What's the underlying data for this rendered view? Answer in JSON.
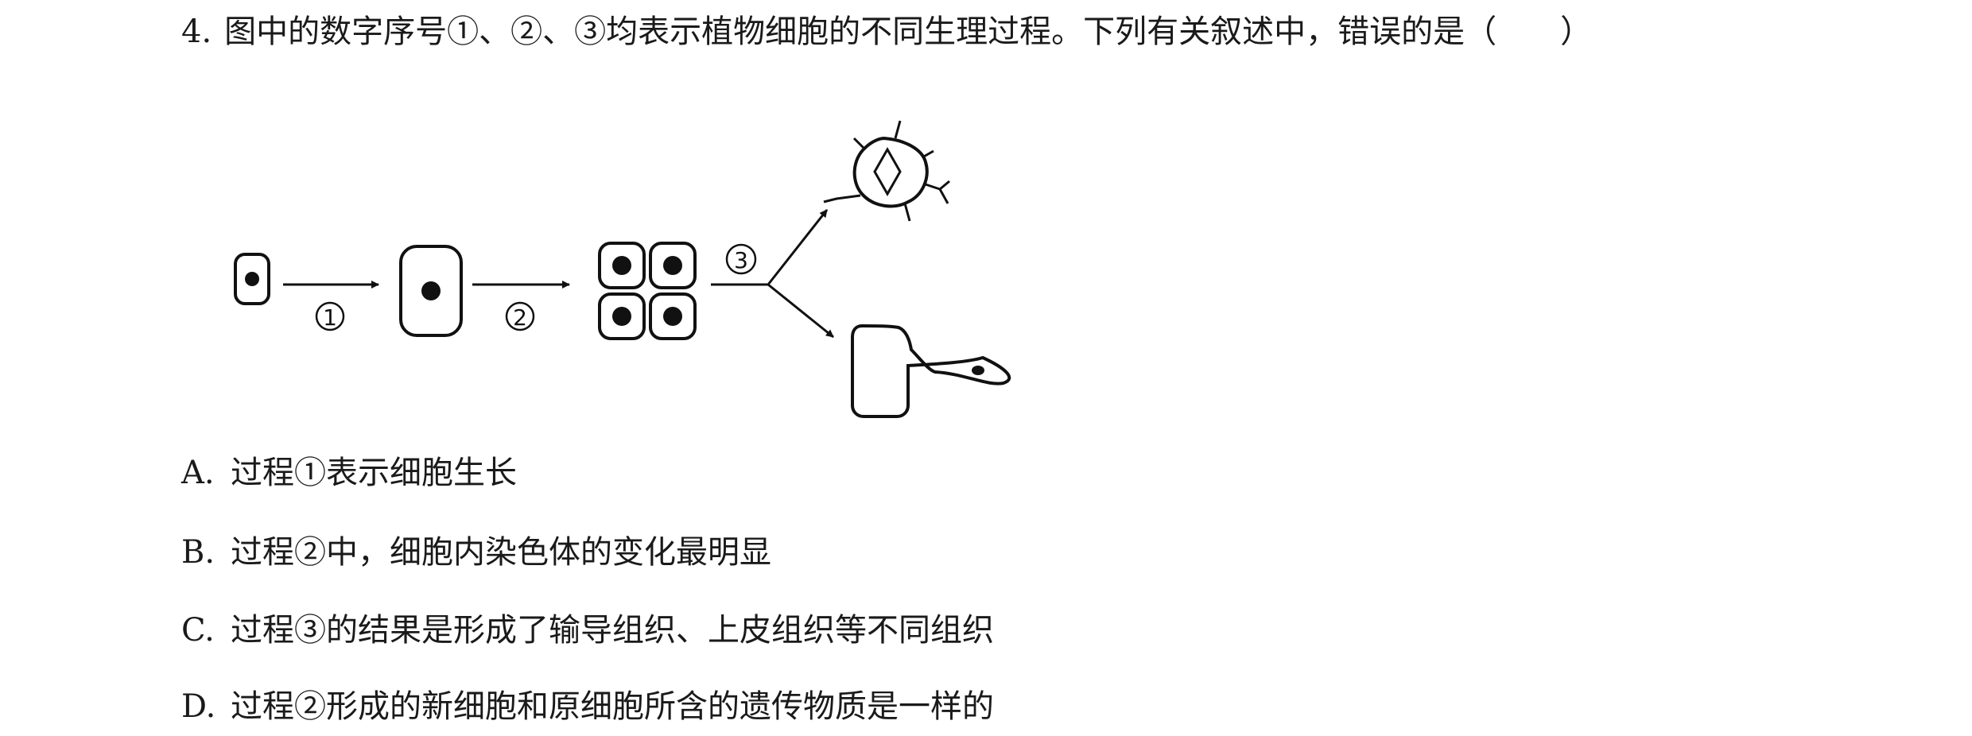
{
  "question": {
    "number": "4.",
    "text": "图中的数字序号①、②、③均表示植物细胞的不同生理过程。下列有关叙述中，错误的是（　　）"
  },
  "figure": {
    "labels": [
      "①",
      "②",
      "③"
    ]
  },
  "options": [
    {
      "letter": "A.",
      "text": "过程①表示细胞生长"
    },
    {
      "letter": "B.",
      "text": "过程②中，细胞内染色体的变化最明显"
    },
    {
      "letter": "C.",
      "text": "过程③的结果是形成了输导组织、上皮组织等不同组织"
    },
    {
      "letter": "D.",
      "text": "过程②形成的新细胞和原细胞所含的遗传物质是一样的"
    }
  ]
}
